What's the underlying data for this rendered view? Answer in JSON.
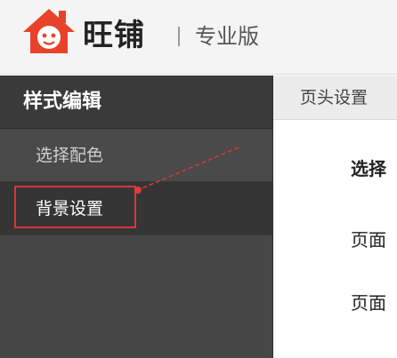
{
  "header": {
    "brand": "旺铺",
    "edition": "专业版"
  },
  "sidebar": {
    "title": "样式编辑",
    "items": [
      {
        "label": "选择配色"
      },
      {
        "label": "背景设置"
      }
    ]
  },
  "main": {
    "tabs": [
      {
        "label": "页头设置"
      }
    ],
    "rows": [
      {
        "label": "选择"
      },
      {
        "label": "页面"
      },
      {
        "label": "页面"
      }
    ]
  },
  "colors": {
    "accent": "#e8432a",
    "annotation": "#d73737",
    "sidebar_bg": "#464646"
  }
}
